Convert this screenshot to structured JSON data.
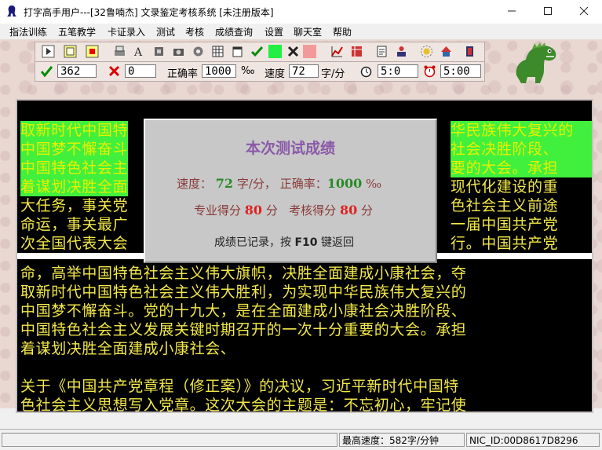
{
  "window": {
    "title": "打字高手用户---[32鲁喃杰]    文录鉴定考核系统  [未注册版本]",
    "minimize_icon": "minimize-icon",
    "maximize_icon": "maximize-icon",
    "close_icon": "close-icon"
  },
  "menu": [
    {
      "label": "指法训练"
    },
    {
      "label": "五笔教学"
    },
    {
      "label": "卡证录入"
    },
    {
      "label": "测试"
    },
    {
      "label": "考核"
    },
    {
      "label": "成绩查询"
    },
    {
      "label": "设置"
    },
    {
      "label": "聊天室"
    },
    {
      "label": "帮助"
    }
  ],
  "stats": {
    "correct": "362",
    "wrong": "0",
    "accuracy_label": "正确率",
    "accuracy": "1000",
    "accuracy_unit": "‰",
    "speed_label": "速度",
    "speed": "72",
    "speed_unit": "字/分",
    "elapsed": "5:0",
    "limit": "5:00"
  },
  "text_lines": [
    {
      "text": "取新时代中国特",
      "hl": true
    },
    {
      "text": "中国梦不懈奋斗",
      "hl": true
    },
    {
      "text": "中国特色社会主",
      "hl": true
    },
    {
      "text": "着谋划决胜全面",
      "hl": true
    },
    {
      "text": "大任务，事关党",
      "hl": false
    },
    {
      "text": "命运，事关最广",
      "hl": false
    },
    {
      "text": "次全国代表大会",
      "hl": false
    }
  ],
  "text_lines_right": [
    {
      "text": "华民族伟大复兴的",
      "hl": true
    },
    {
      "text": "社会决胜阶段、",
      "hl": true
    },
    {
      "text": "要的大会。承担",
      "hl": true
    },
    {
      "text": "现代化建设的重",
      "hl": false
    },
    {
      "text": "色社会主义前途",
      "hl": false
    },
    {
      "text": "一届中国共产党",
      "hl": false
    },
    {
      "text": "行。中国共产党",
      "hl": false
    }
  ],
  "text_lines_lower": [
    "命，高举中国特色社会主义伟大旗帜，决胜全面建成小康社会，夺",
    "取新时代中国特色社会主义伟大胜利，为实现中华民族伟大复兴的",
    "中国梦不懈奋斗。党的十九大，是在全面建成小康社会决胜阶段、",
    "中国特色社会主义发展关键时期召开的一次十分重要的大会。承担",
    "着谋划决胜全面建成小康社会、",
    "",
    "关于《中国共产党章程（修正案）》的决议，习近平新时代中国特",
    "色社会主义思想写入党章。这次大会的主题是：不忘初心，牢记使"
  ],
  "dialog": {
    "title": "本次测试成绩",
    "speed_label": "速度：",
    "speed_value": "72",
    "speed_unit": "字/分，",
    "accuracy_label": "正确率：",
    "accuracy_value": "1000",
    "accuracy_unit": "‰",
    "pro_label": "专业得分",
    "pro_value": "80",
    "pro_unit": "分",
    "exam_label": "考核得分",
    "exam_value": "80",
    "exam_unit": "分",
    "note_prefix": "成绩已记录，按",
    "note_key": "F10",
    "note_suffix": "键返回"
  },
  "status": {
    "max_speed": "最高速度：582字/分钟",
    "nic_id": "NIC_ID:00D8617D8296"
  },
  "colors": {
    "highlight": "#41f03c",
    "text": "#f2e84a",
    "dialog_green": "#2a8a2a",
    "dialog_red": "#e02020",
    "dialog_title": "#8a5aa8"
  }
}
